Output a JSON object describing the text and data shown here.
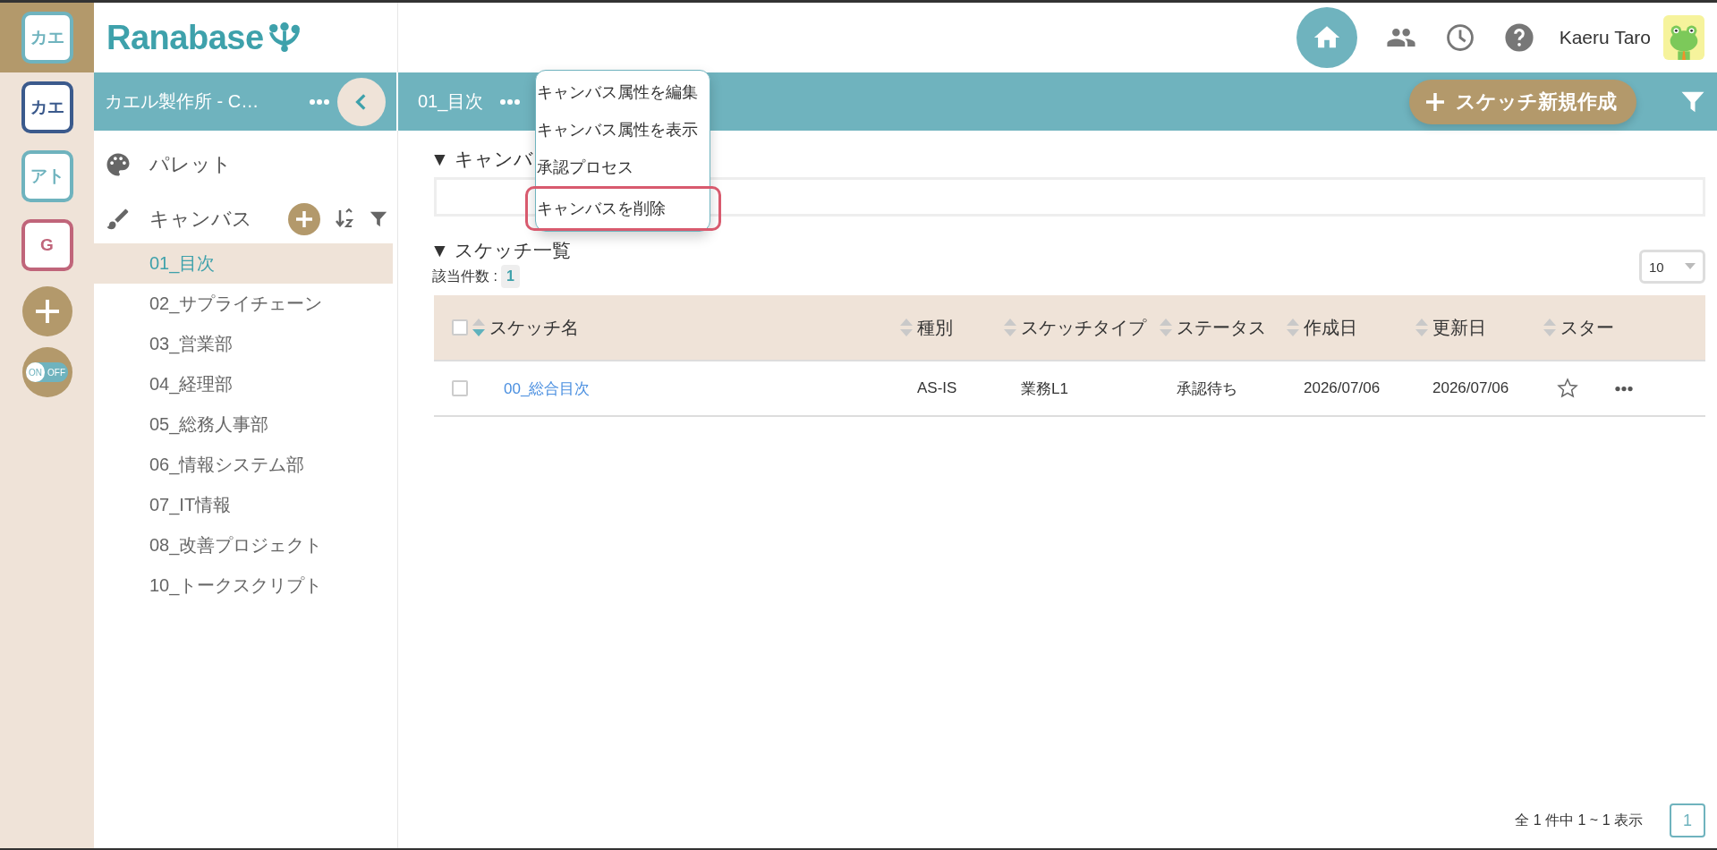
{
  "rail": {
    "workspaces": [
      {
        "label": "カエ",
        "color": "#6fb3be",
        "selected": true
      },
      {
        "label": "カエ",
        "color": "#3b5a8c",
        "selected": false
      },
      {
        "label": "アト",
        "color": "#6fb3be",
        "selected": false
      },
      {
        "label": "G",
        "color": "#c0657a",
        "selected": false
      }
    ],
    "toggle": {
      "on_label": "ON",
      "off_label": "OFF",
      "on": true
    }
  },
  "logo": {
    "text": "Ranabase"
  },
  "header": {
    "user_name": "Kaeru Taro"
  },
  "sidebar": {
    "title": "カエル製作所 - C…",
    "palette_label": "パレット",
    "canvas_label": "キャンバス",
    "items": [
      {
        "label": "01_目次",
        "selected": true
      },
      {
        "label": "02_サプライチェーン",
        "selected": false
      },
      {
        "label": "03_営業部",
        "selected": false
      },
      {
        "label": "04_経理部",
        "selected": false
      },
      {
        "label": "05_総務人事部",
        "selected": false
      },
      {
        "label": "06_情報システム部",
        "selected": false
      },
      {
        "label": "07_IT情報",
        "selected": false
      },
      {
        "label": "08_改善プロジェクト",
        "selected": false
      },
      {
        "label": "10_トークスクリプト",
        "selected": false
      }
    ]
  },
  "toolbar": {
    "title": "01_目次",
    "new_button": "スケッチ新規作成"
  },
  "menu": {
    "items": [
      {
        "label": "キャンバス属性を編集",
        "highlighted": false
      },
      {
        "label": "キャンバス属性を表示",
        "highlighted": false
      },
      {
        "label": "承認プロセス",
        "highlighted": false
      },
      {
        "label": "キャンバスを削除",
        "highlighted": true
      }
    ]
  },
  "canvas_section": {
    "title": "▼ キャンバ"
  },
  "sketch_section": {
    "title": "▼ スケッチ一覧",
    "count_label": "該当件数 :",
    "count": "1",
    "page_size": "10"
  },
  "table": {
    "all_checked": false,
    "columns": [
      {
        "label": "スケッチ名",
        "sorted": true
      },
      {
        "label": "種別",
        "sorted": false
      },
      {
        "label": "スケッチタイプ",
        "sorted": false
      },
      {
        "label": "ステータス",
        "sorted": false
      },
      {
        "label": "作成日",
        "sorted": false
      },
      {
        "label": "更新日",
        "sorted": false
      },
      {
        "label": "スター",
        "sorted": false
      }
    ],
    "rows": [
      {
        "checked": false,
        "name": "00_総合目次",
        "kind": "AS-IS",
        "type": "業務L1",
        "status": "承認待ち",
        "created": "2026/07/06",
        "updated": "2026/07/06",
        "starred": false
      }
    ]
  },
  "pagination": {
    "summary": "全 1 件中 1 ~ 1 表示",
    "pages": [
      {
        "label": "1",
        "selected": true
      }
    ]
  }
}
